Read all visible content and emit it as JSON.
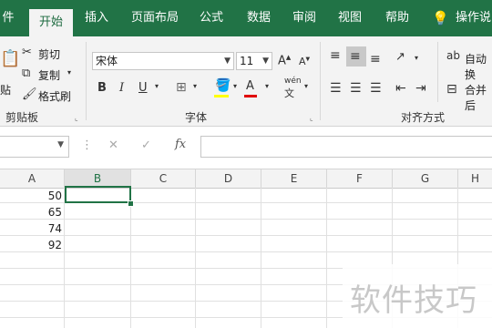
{
  "tabs": [
    "件",
    "开始",
    "插入",
    "页面布局",
    "公式",
    "数据",
    "审阅",
    "视图",
    "帮助",
    "操作说"
  ],
  "clipboard": {
    "paste_label": "贴",
    "cut_label": "剪切",
    "copy_label": "复制",
    "format_painter_label": "格式刷",
    "group_label": "剪贴板"
  },
  "font": {
    "font_name": "宋体",
    "font_size": "11",
    "bold": "B",
    "italic": "I",
    "underline": "U",
    "phonetic_label": "wén",
    "grow_font": "A",
    "shrink_font": "A",
    "group_label": "字体"
  },
  "alignment": {
    "wrap_label": "自动换",
    "merge_label": "合并后",
    "group_label": "对齐方式"
  },
  "formula_bar": {
    "cancel": "✕",
    "enter": "✓",
    "fx": "fx",
    "divider": "⋮"
  },
  "grid": {
    "columns": [
      "A",
      "B",
      "C",
      "D",
      "E",
      "F",
      "G",
      "H"
    ],
    "selected_column": "B",
    "values": [
      "50",
      "65",
      "74",
      "92"
    ]
  },
  "watermark": "软件技巧"
}
